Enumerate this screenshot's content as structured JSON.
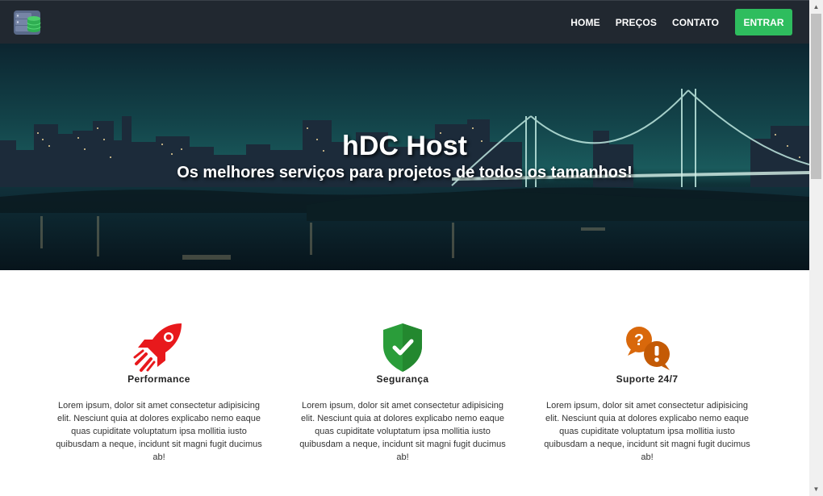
{
  "navbar": {
    "logo_icon": "server-database-icon",
    "links": [
      {
        "label": "HOME"
      },
      {
        "label": "PREÇOS"
      },
      {
        "label": "CONTATO"
      }
    ],
    "enter_label": "ENTRAR"
  },
  "hero": {
    "title": "hDC Host",
    "subtitle": "Os melhores serviços para projetos de todos os tamanhos!"
  },
  "features": [
    {
      "icon": "rocket-icon",
      "title": "Performance",
      "text": "Lorem ipsum, dolor sit amet consectetur adipisicing elit. Nesciunt quia at dolores explicabo nemo eaque quas cupiditate voluptatum ipsa mollitia iusto quibusdam a neque, incidunt sit magni fugit ducimus ab!"
    },
    {
      "icon": "shield-check-icon",
      "title": "Segurança",
      "text": "Lorem ipsum, dolor sit amet consectetur adipisicing elit. Nesciunt quia at dolores explicabo nemo eaque quas cupiditate voluptatum ipsa mollitia iusto quibusdam a neque, incidunt sit magni fugit ducimus ab!"
    },
    {
      "icon": "question-exclamation-icon",
      "title": "Suporte 24/7",
      "text": "Lorem ipsum, dolor sit amet consectetur adipisicing elit. Nesciunt quia at dolores explicabo nemo eaque quas cupiditate voluptatum ipsa mollitia iusto quibusdam a neque, incidunt sit magni fugit ducimus ab!"
    }
  ],
  "colors": {
    "navbar_bg": "#212830",
    "enter_button": "#2ebd5e",
    "rocket": "#e8191c",
    "shield": "#2a9d3a",
    "support": "#d9680b"
  }
}
